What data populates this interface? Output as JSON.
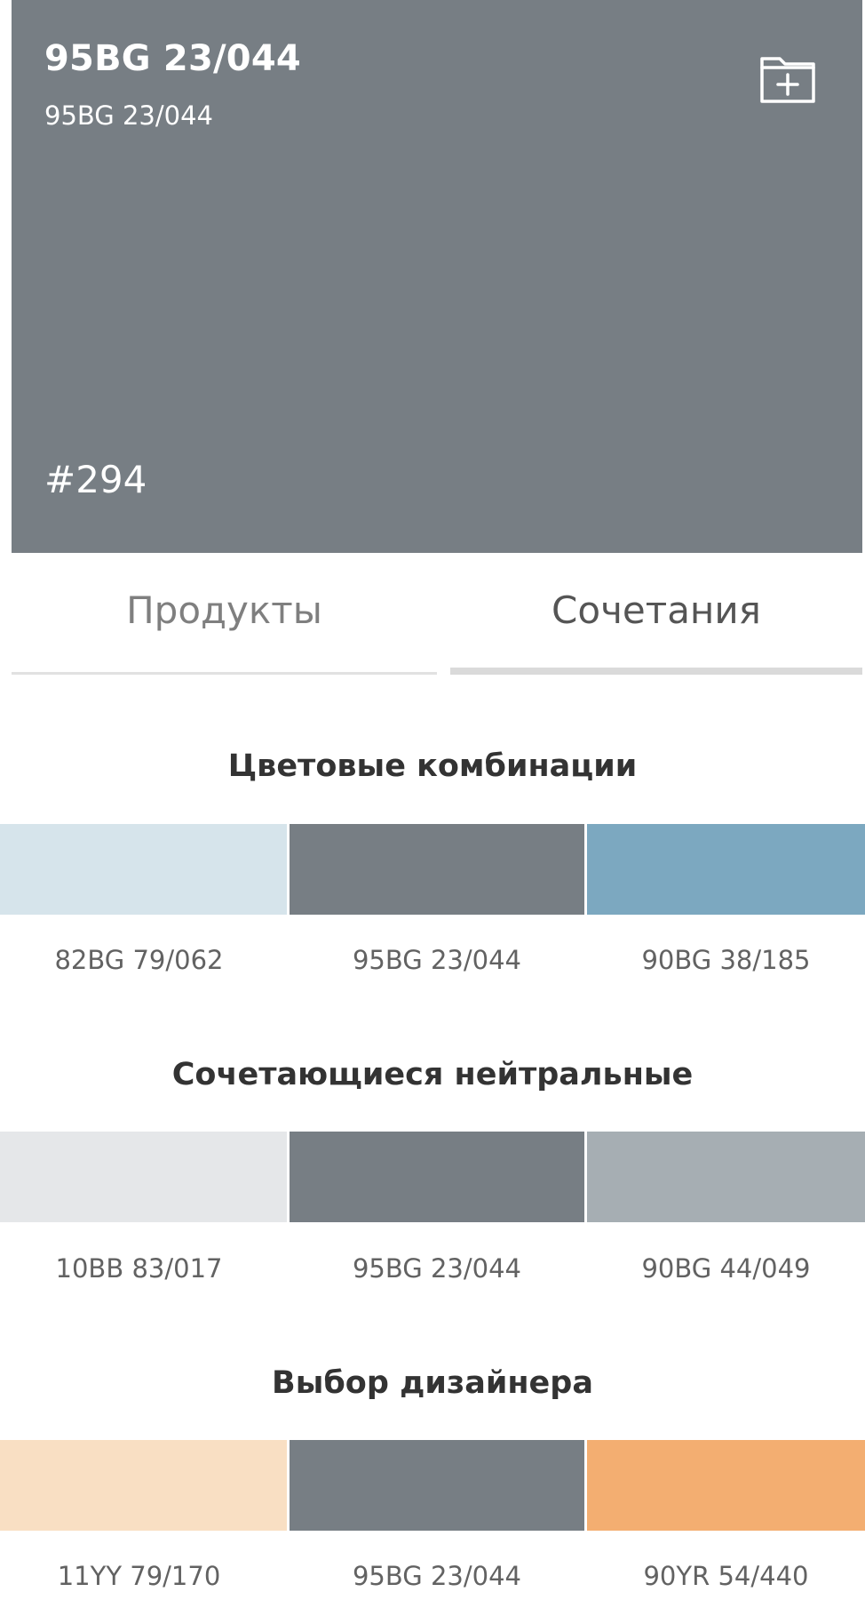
{
  "color": {
    "title": "95BG 23/044",
    "subtitle": "95BG 23/044",
    "number": "#294",
    "hex": "#777e84"
  },
  "icons": {
    "add_to_folder": "folder-plus-icon"
  },
  "tabs": [
    {
      "label": "Продукты",
      "active": false
    },
    {
      "label": "Сочетания",
      "active": true
    }
  ],
  "sections": [
    {
      "title": "Цветовые комбинации",
      "swatches": [
        {
          "code": "82BG 79/062",
          "color": "#d6e4eb"
        },
        {
          "code": "95BG 23/044",
          "color": "#777e84"
        },
        {
          "code": "90BG 38/185",
          "color": "#7ca8c0"
        }
      ]
    },
    {
      "title": "Сочетающиеся нейтральные",
      "swatches": [
        {
          "code": "10BB 83/017",
          "color": "#e5e7e9"
        },
        {
          "code": "95BG 23/044",
          "color": "#777e84"
        },
        {
          "code": "90BG 44/049",
          "color": "#a6aeb3"
        }
      ]
    },
    {
      "title": "Выбор дизайнера",
      "swatches": [
        {
          "code": "11YY 79/170",
          "color": "#f9dfc3"
        },
        {
          "code": "95BG 23/044",
          "color": "#777e84"
        },
        {
          "code": "90YR 54/440",
          "color": "#f3ae71"
        }
      ]
    }
  ]
}
